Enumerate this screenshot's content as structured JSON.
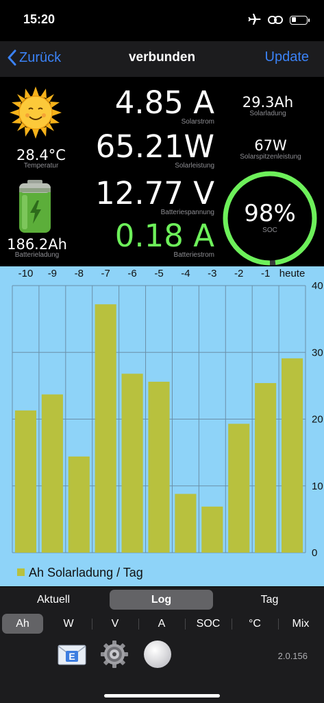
{
  "status": {
    "time": "15:20"
  },
  "nav": {
    "back_label": "Zurück",
    "title": "verbunden",
    "update_label": "Update"
  },
  "dashboard": {
    "temperature": {
      "value": "28.4°C",
      "label": "Temperatur"
    },
    "battery_charge": {
      "value": "186.2Ah",
      "label": "Batterieladung"
    },
    "solar_current": {
      "value": "4.85 A",
      "label": "Solarstrom"
    },
    "solar_power": {
      "value": "65.21W",
      "label": "Solarleistung"
    },
    "battery_voltage": {
      "value": "12.77 V",
      "label": "Batteriespannung"
    },
    "battery_current": {
      "value": "0.18 A",
      "label": "Batteriestrom"
    },
    "solar_charge": {
      "value": "29.3Ah",
      "label": "Solarladung"
    },
    "solar_peak_power": {
      "value": "67W",
      "label": "Solarspitzenleistung"
    },
    "soc": {
      "value": "98%",
      "label": "SOC",
      "fraction": 0.98
    }
  },
  "chart_data": {
    "type": "bar",
    "categories": [
      "-10",
      "-9",
      "-8",
      "-7",
      "-6",
      "-5",
      "-4",
      "-3",
      "-2",
      "-1",
      "heute"
    ],
    "series": [
      {
        "name": "Ah Solarladung / Tag",
        "values": [
          21.3,
          23.7,
          14.4,
          37.2,
          26.8,
          25.6,
          8.8,
          6.9,
          19.3,
          25.4,
          29.1
        ]
      }
    ],
    "y_ticks": [
      "0",
      "10",
      "20",
      "30",
      "40"
    ],
    "ylim": [
      0,
      40
    ],
    "grid": true,
    "legend_position": "bottom-left",
    "colors": {
      "bar": "#b8c13e",
      "background": "#8ed3f8",
      "grid": "#6a8fa8"
    }
  },
  "tabs_top": [
    {
      "label": "Aktuell",
      "active": false
    },
    {
      "label": "Log",
      "active": true
    },
    {
      "label": "Tag",
      "active": false
    }
  ],
  "tabs_units": [
    {
      "label": "Ah",
      "active": true
    },
    {
      "label": "W",
      "active": false
    },
    {
      "label": "V",
      "active": false
    },
    {
      "label": "A",
      "active": false
    },
    {
      "label": "SOC",
      "active": false
    },
    {
      "label": "°C",
      "active": false
    },
    {
      "label": "Mix",
      "active": false
    }
  ],
  "toolbar": {
    "version": "2.0.156",
    "mail_badge_letter": "E"
  },
  "icons": {
    "airplane": "airplane-icon",
    "link": "link-icon",
    "battery": "battery-icon",
    "sun": "sun-icon",
    "battery_large": "battery-charge-icon",
    "mail": "mail-icon",
    "settings": "gear-icon",
    "record": "record-button-icon"
  }
}
